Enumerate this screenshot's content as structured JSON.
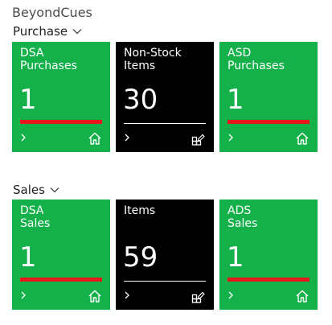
{
  "app": {
    "title": "BeyondCues"
  },
  "groups": [
    {
      "title": "Purchase",
      "tiles": [
        {
          "label_line1": "DSA",
          "label_line2": "Purchases",
          "value": "1",
          "style": "green",
          "icon": "home-icon",
          "indicator": "red-bar"
        },
        {
          "label_line1": "Non-Stock",
          "label_line2": "Items",
          "value": "30",
          "style": "black",
          "icon": "grid-edit-icon",
          "indicator": "white-rule"
        },
        {
          "label_line1": "ASD",
          "label_line2": "Purchases",
          "value": "1",
          "style": "green",
          "icon": "home-icon",
          "indicator": "red-bar"
        }
      ]
    },
    {
      "title": "Sales",
      "tiles": [
        {
          "label_line1": "DSA",
          "label_line2": "Sales",
          "value": "1",
          "style": "green",
          "icon": "home-icon",
          "indicator": "red-bar"
        },
        {
          "label_line1": "Items",
          "label_line2": "",
          "value": "59",
          "style": "black",
          "icon": "grid-edit-icon",
          "indicator": "white-rule"
        },
        {
          "label_line1": "ADS",
          "label_line2": "Sales",
          "value": "1",
          "style": "green",
          "icon": "home-icon",
          "indicator": "red-bar"
        }
      ]
    }
  ],
  "colors": {
    "tile_green": "#14b14b",
    "tile_black": "#000000",
    "indicator_red": "#e8171c",
    "text_white": "#ffffff"
  }
}
